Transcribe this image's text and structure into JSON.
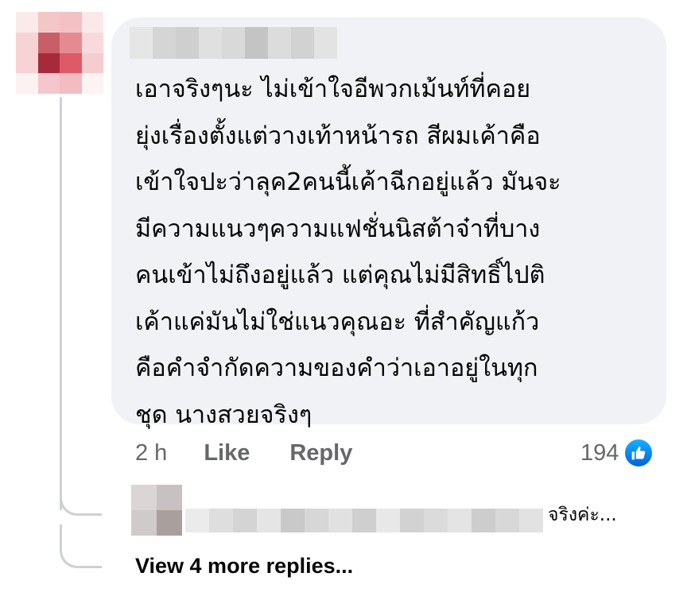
{
  "comment": {
    "author_name_visible": "",
    "text": "เอาจริงๆนะ ไม่เข้าใจอีพวกเม้นท์ที่คอย\nยุ่งเรื่องตั้งแต่วางเท้าหน้ารถ สีผมเค้าคือ\nเข้าใจปะว่าลุค2คนนี้เค้าฉีกอยู่แล้ว มันจะ\nมีความแนวๆความแฟชั่นนิสต้าจ๋าที่บาง\nคนเข้าไม่ถึงอยู่แล้ว แต่คุณไม่มีสิทธิ์ไปติ\nเค้าแค่มันไม่ใช่แนวคุณอะ ที่สำคัญแก้ว\nคือคำจำกัดความของคำว่าเอาอยู่ในทุก\nชุด นางสวยจริงๆ",
    "time": "2 h",
    "like_label": "Like",
    "reply_label": "Reply",
    "reaction_count": "194",
    "reaction_icon": "thumbs-up-icon"
  },
  "reply_preview": {
    "snippet": "จริงค่ะ..."
  },
  "view_more_label": "View 4 more replies...",
  "colors": {
    "bubble_bg": "#f0f2f5",
    "meta_text": "#65676b",
    "like_blue": "#1877f2",
    "thread_line": "#ced0d4"
  }
}
